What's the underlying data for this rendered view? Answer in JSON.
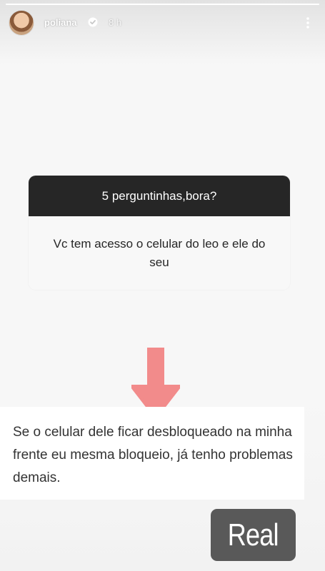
{
  "story": {
    "progress_fraction": 1.0,
    "username": "poliana",
    "time_ago": "8 h",
    "verified": true,
    "more_icon": "more-vertical-icon"
  },
  "question_sticker": {
    "header": "5 perguntinhas,bora?",
    "question": "Vc tem acesso o celular do leo e ele do seu"
  },
  "arrow": {
    "icon": "arrow-down-icon",
    "color": "#f28b8b"
  },
  "tweet": {
    "text": "Se o celular dele ficar desbloqueado na minha frente eu mesma bloqueio, já tenho problemas demais."
  },
  "badge": {
    "label": "Real",
    "color": "#595959"
  },
  "colors": {
    "sticker_header": "#262626",
    "background": "#f7f7f7"
  }
}
